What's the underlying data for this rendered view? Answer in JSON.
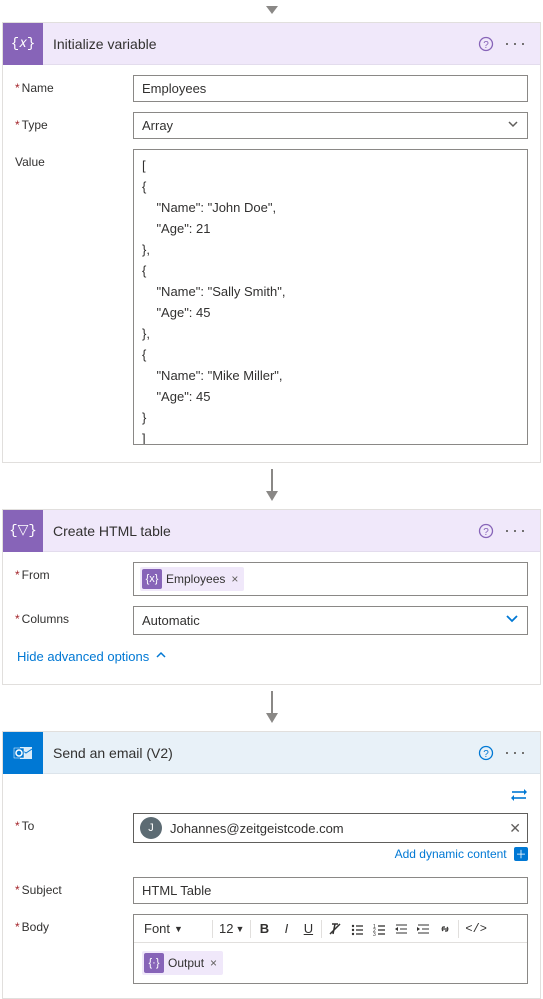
{
  "connector_top": true,
  "init_var": {
    "title": "Initialize variable",
    "name_label": "Name",
    "type_label": "Type",
    "value_label": "Value",
    "name_value": "Employees",
    "type_value": "Array",
    "value_text": "[\n{\n    \"Name\": \"John Doe\",\n    \"Age\": 21\n},\n{\n    \"Name\": \"Sally Smith\",\n    \"Age\": 45\n},\n{\n    \"Name\": \"Mike Miller\",\n    \"Age\": 45\n}\n]"
  },
  "html_table": {
    "title": "Create HTML table",
    "from_label": "From",
    "from_pill": "Employees",
    "columns_label": "Columns",
    "columns_value": "Automatic",
    "advanced_label": "Hide advanced options"
  },
  "email": {
    "title": "Send an email (V2)",
    "to_label": "To",
    "to_value": "Johannes@zeitgeistcode.com",
    "to_avatar": "J",
    "dyn_label": "Add dynamic content",
    "subject_label": "Subject",
    "subject_value": "HTML Table",
    "body_label": "Body",
    "font_label": "Font",
    "size_label": "12",
    "output_pill": "Output"
  }
}
